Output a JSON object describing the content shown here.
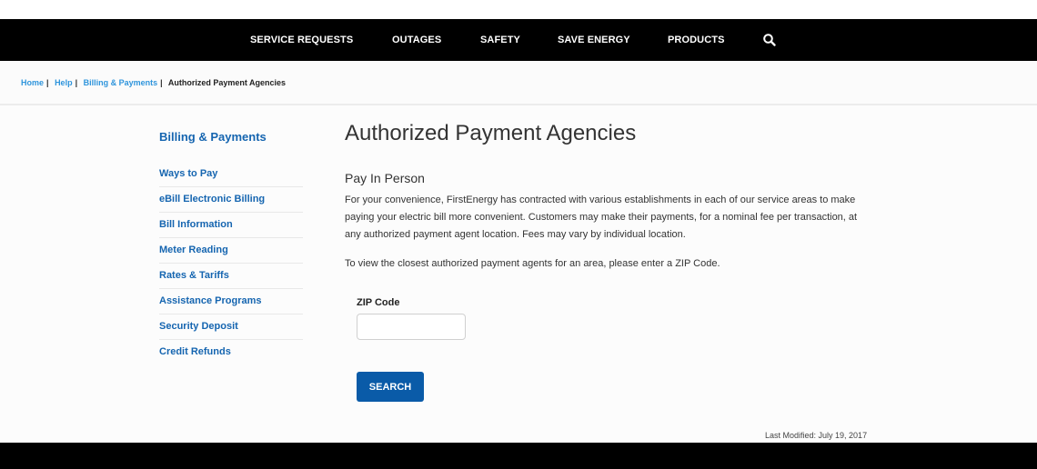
{
  "nav": {
    "items": [
      {
        "label": "SERVICE REQUESTS"
      },
      {
        "label": "OUTAGES"
      },
      {
        "label": "SAFETY"
      },
      {
        "label": "SAVE ENERGY"
      },
      {
        "label": "PRODUCTS"
      }
    ],
    "search_icon": "search-icon"
  },
  "breadcrumb": {
    "items": [
      {
        "label": "Home"
      },
      {
        "label": "Help"
      },
      {
        "label": "Billing & Payments"
      }
    ],
    "separator": "|",
    "current": "Authorized Payment Agencies"
  },
  "sidebar": {
    "title": "Billing & Payments",
    "items": [
      {
        "label": "Ways to Pay"
      },
      {
        "label": "eBill Electronic Billing"
      },
      {
        "label": "Bill Information"
      },
      {
        "label": "Meter Reading"
      },
      {
        "label": "Rates & Tariffs"
      },
      {
        "label": "Assistance Programs"
      },
      {
        "label": "Security Deposit"
      },
      {
        "label": "Credit Refunds"
      }
    ]
  },
  "main": {
    "title": "Authorized Payment Agencies",
    "section_title": "Pay In Person",
    "paragraph": "For your convenience, FirstEnergy has contracted with various establishments in each of our service areas to make paying your electric bill more convenient. Customers may make their payments, for a nominal fee per transaction, at any authorized payment agent location. Fees may vary by individual location.",
    "instruction": "To view the closest authorized payment agents for an area, please enter a ZIP Code.",
    "zip_label": "ZIP Code",
    "zip_value": "",
    "zip_placeholder": "",
    "search_button": "SEARCH",
    "last_modified": "Last Modified: July 19, 2017"
  },
  "colors": {
    "nav_bg": "#000000",
    "link_blue": "#2f95dc",
    "sidebar_blue": "#1565b0",
    "button_blue": "#0a5ba8"
  }
}
